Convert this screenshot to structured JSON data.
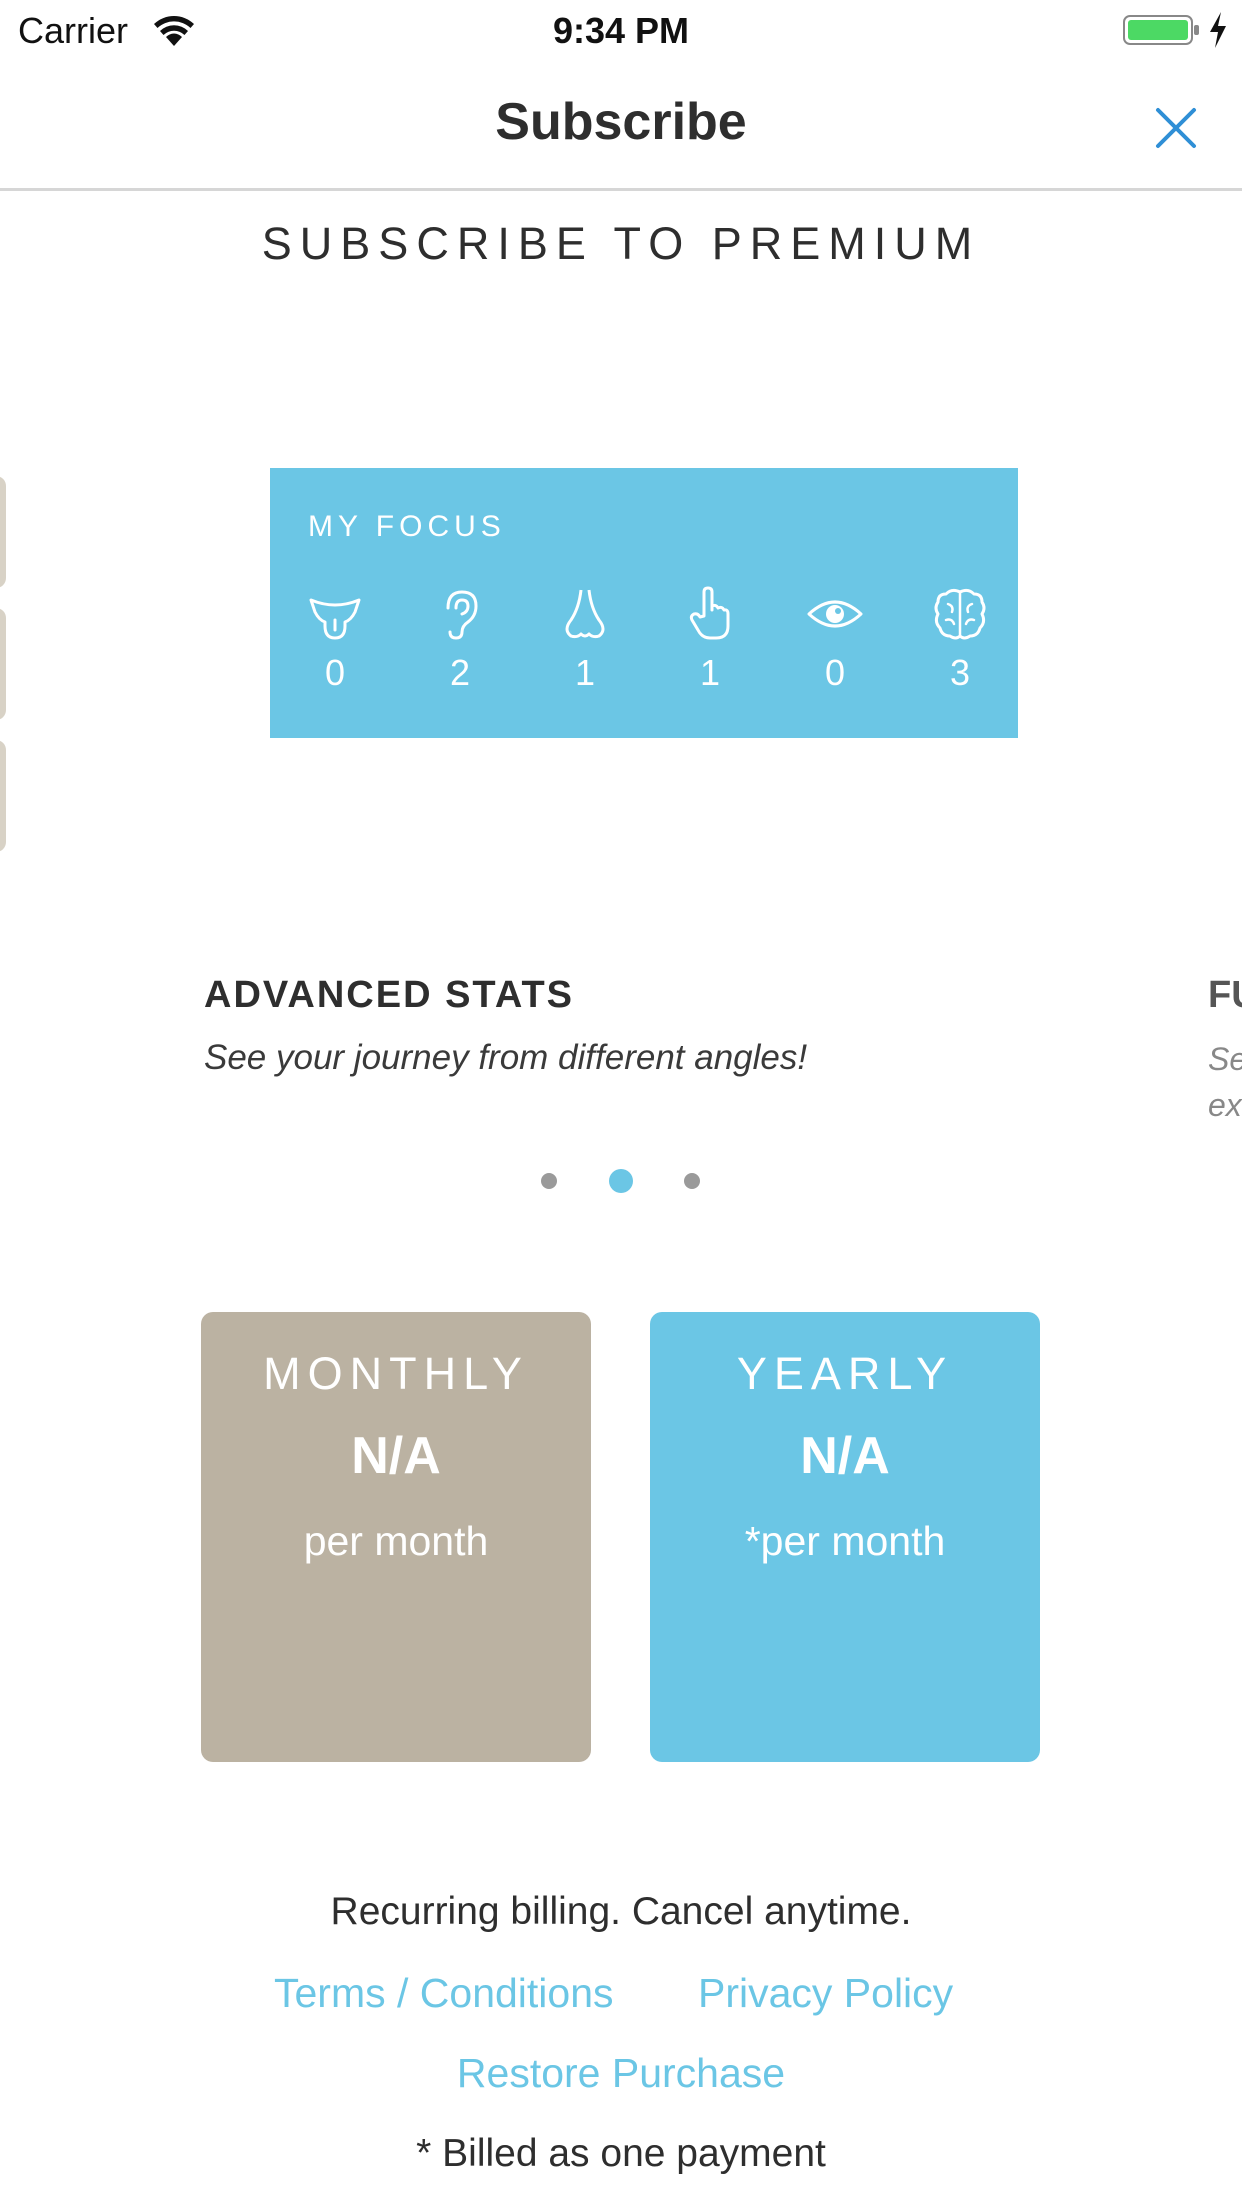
{
  "status_bar": {
    "carrier": "Carrier",
    "time": "9:34 PM"
  },
  "nav": {
    "title": "Subscribe",
    "close_icon": "close-icon"
  },
  "heading": "SUBSCRIBE TO PREMIUM",
  "focus_card": {
    "label": "MY FOCUS",
    "items": [
      {
        "icon": "tongue-icon",
        "count": "0"
      },
      {
        "icon": "ear-icon",
        "count": "2"
      },
      {
        "icon": "nose-icon",
        "count": "1"
      },
      {
        "icon": "hand-pointer-icon",
        "count": "1"
      },
      {
        "icon": "eye-icon",
        "count": "0"
      },
      {
        "icon": "brain-icon",
        "count": "3"
      }
    ]
  },
  "carousel": {
    "current": {
      "title": "ADVANCED STATS",
      "description": "See your journey from different angles!"
    },
    "next_partial": {
      "title": "FU",
      "description_line1": "Se",
      "description_line2": "ex"
    },
    "page_count": 3,
    "active_page": 2
  },
  "plans": {
    "monthly": {
      "name": "MONTHLY",
      "price": "N/A",
      "unit": "per month"
    },
    "yearly": {
      "name": "YEARLY",
      "price": "N/A",
      "unit": "*per month"
    }
  },
  "footer": {
    "billing_note": "Recurring billing. Cancel anytime.",
    "terms_link": "Terms / Conditions",
    "privacy_link": "Privacy Policy",
    "restore_link": "Restore Purchase",
    "billed_note": "* Billed as one payment"
  },
  "colors": {
    "accent": "#6bc6e5",
    "monthly_card": "#bbb2a2",
    "battery": "#4cd964"
  }
}
